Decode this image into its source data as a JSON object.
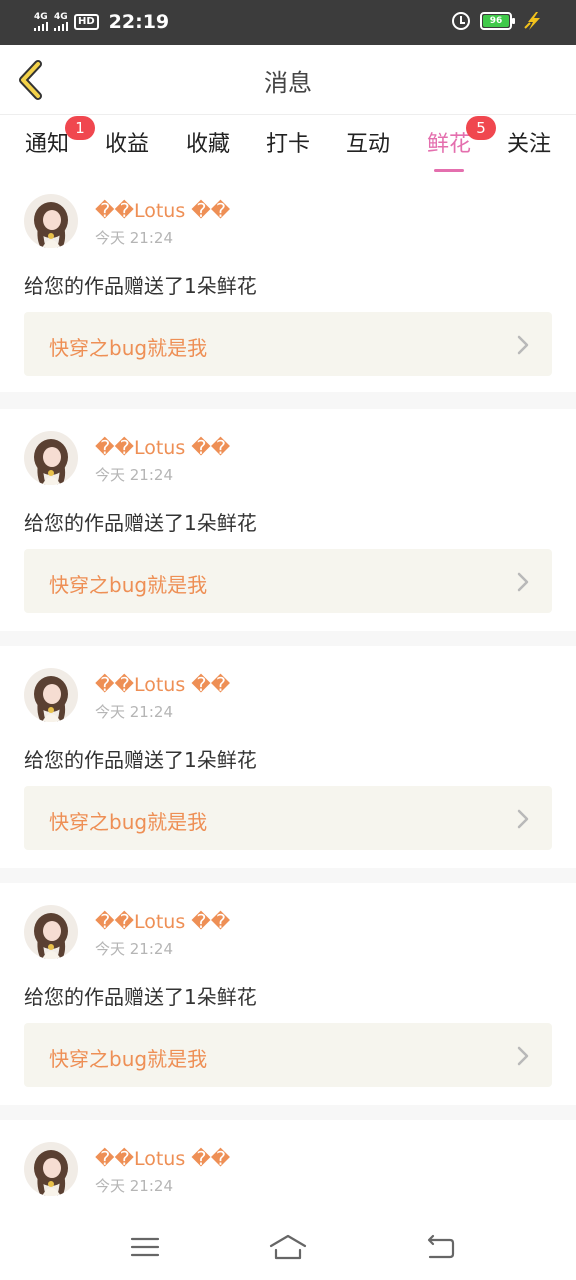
{
  "status_bar": {
    "network_1": "4G",
    "network_2": "4G",
    "hd": "HD",
    "time": "22:19",
    "battery": "96",
    "icons": [
      "signal-icon",
      "hd-icon",
      "alarm-icon",
      "battery-icon",
      "charging-bolt-icon"
    ]
  },
  "header": {
    "title": "消息",
    "back_icon": "chevron-left-icon"
  },
  "tabs": [
    {
      "label": "通知",
      "badge": "1",
      "active": false
    },
    {
      "label": "收益",
      "badge": "",
      "active": false
    },
    {
      "label": "收藏",
      "badge": "",
      "active": false
    },
    {
      "label": "打卡",
      "badge": "",
      "active": false
    },
    {
      "label": "互动",
      "badge": "",
      "active": false
    },
    {
      "label": "鲜花",
      "badge": "5",
      "active": true
    },
    {
      "label": "关注",
      "badge": "",
      "active": false
    }
  ],
  "messages": [
    {
      "sender": "��Lotus ��",
      "time": "今天 21:24",
      "text": "给您的作品赠送了1朵鲜花",
      "work": "快穿之bug就是我"
    },
    {
      "sender": "��Lotus ��",
      "time": "今天 21:24",
      "text": "给您的作品赠送了1朵鲜花",
      "work": "快穿之bug就是我"
    },
    {
      "sender": "��Lotus ��",
      "time": "今天 21:24",
      "text": "给您的作品赠送了1朵鲜花",
      "work": "快穿之bug就是我"
    },
    {
      "sender": "��Lotus ��",
      "time": "今天 21:24",
      "text": "给您的作品赠送了1朵鲜花",
      "work": "快穿之bug就是我"
    },
    {
      "sender": "��Lotus ��",
      "time": "今天 21:24",
      "text": "",
      "work": ""
    }
  ],
  "navbar": {
    "icons": [
      "menu-icon",
      "home-icon",
      "back-icon"
    ]
  },
  "colors": {
    "accent": "#e46fae",
    "sender": "#ee8f55",
    "badge": "#f0474f",
    "status_bar": "#3c3c3c",
    "work_box": "#f6f5ee"
  }
}
